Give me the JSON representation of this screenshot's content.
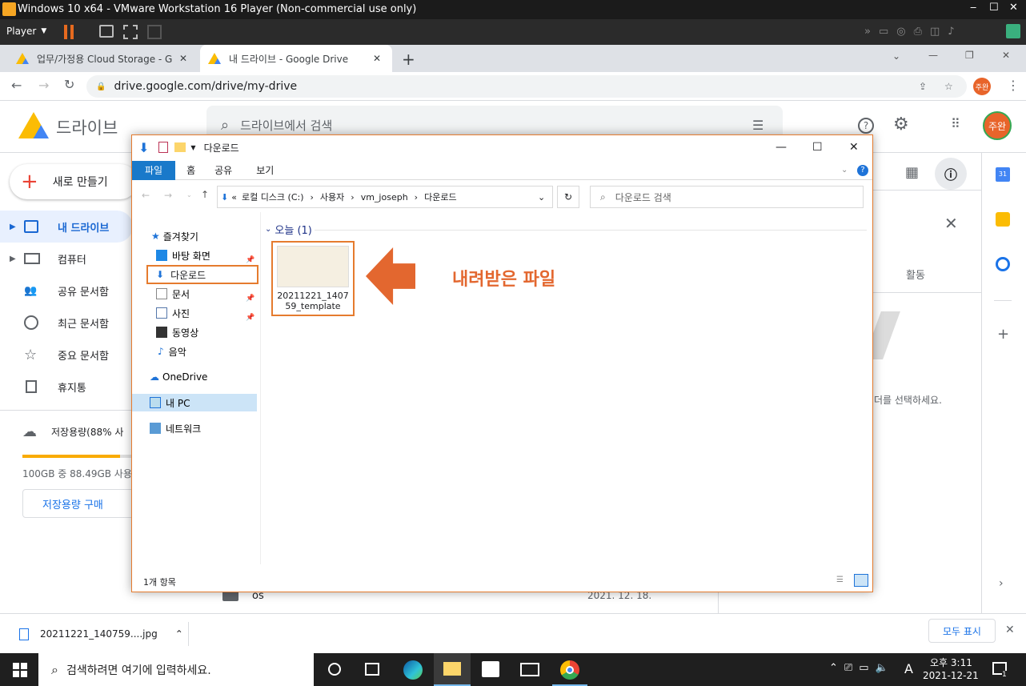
{
  "vm": {
    "title": "Windows 10 x64 - VMware Workstation 16 Player (Non-commercial use only)",
    "player_menu": "Player"
  },
  "chrome": {
    "tabs": [
      {
        "label": "업무/가정용 Cloud Storage - Go"
      },
      {
        "label": "내 드라이브 - Google Drive"
      }
    ],
    "url": "drive.google.com/drive/my-drive",
    "profile": "주완"
  },
  "drive": {
    "brand": "드라이브",
    "search_placeholder": "드라이브에서 검색",
    "new_button": "새로 만들기",
    "nav": [
      {
        "label": "내 드라이브"
      },
      {
        "label": "컴퓨터"
      },
      {
        "label": "공유 문서함"
      },
      {
        "label": "최근 문서함"
      },
      {
        "label": "중요 문서함"
      },
      {
        "label": "휴지통"
      }
    ],
    "storage_label": "저장용량(88% 사",
    "storage_usage": "100GB 중 88.49GB 사용",
    "storage_fraction": 0.885,
    "buy_storage": "저장용량 구매",
    "details_activity": "활동",
    "details_hint": "더를 선택하세요.",
    "file_row_name": "os",
    "file_row_date": "2021. 12. 18.",
    "profile": "주완"
  },
  "explorer": {
    "title": "다운로드",
    "ribbon": {
      "file": "파일",
      "home": "홈",
      "share": "공유",
      "view": "보기"
    },
    "breadcrumb": [
      "로컬 디스크 (C:)",
      "사용자",
      "vm_joseph",
      "다운로드"
    ],
    "search_placeholder": "다운로드 검색",
    "quick_access": "즐겨찾기",
    "nav": [
      "바탕 화면",
      "다운로드",
      "문서",
      "사진",
      "동영상",
      "음악"
    ],
    "onedrive": "OneDrive",
    "thispc": "내 PC",
    "network": "네트워크",
    "group_header": "오늘 (1)",
    "file_name_line1": "20211221_1407",
    "file_name_line2": "59_template",
    "status": "1개 항목"
  },
  "annotation": {
    "text": "내려받은 파일",
    "color": "#e3672f"
  },
  "download": {
    "filename": "20211221_140759....jpg",
    "show_all": "모두 표시"
  },
  "taskbar": {
    "search": "검색하려면 여기에 입력하세요.",
    "time": "오후 3:11",
    "date": "2021-12-21",
    "ime": "A",
    "notif_count": "1"
  }
}
